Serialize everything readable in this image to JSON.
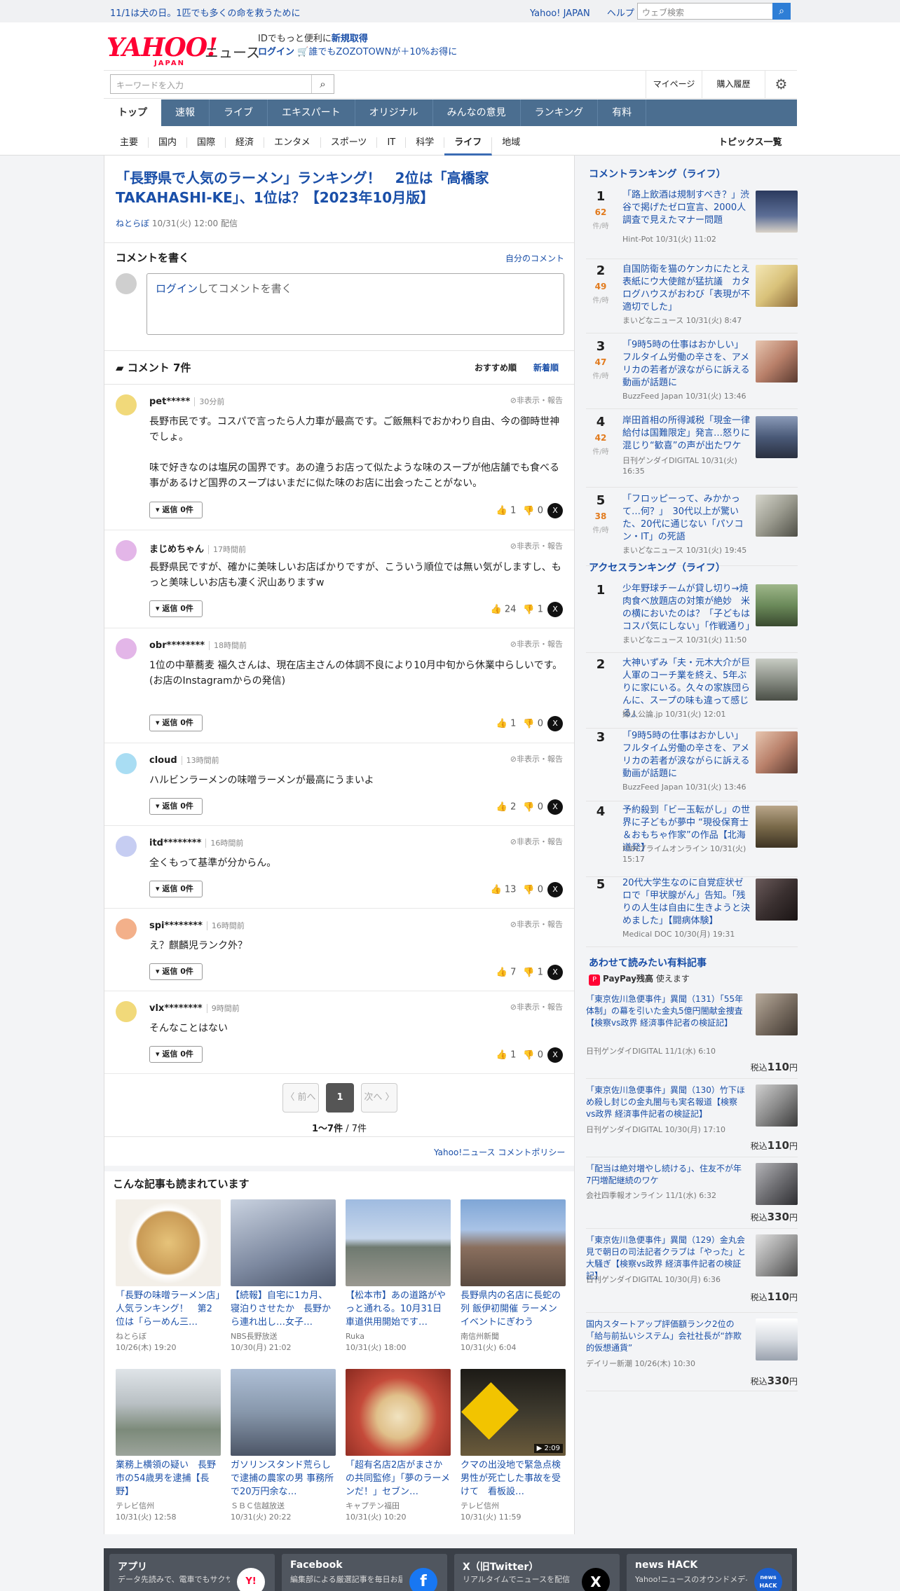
{
  "topbar": {
    "notice": "11/1は犬の日。1匹でも多くの命を救うために",
    "links": [
      "Yahoo! JAPAN",
      "ヘルプ"
    ],
    "search_placeholder": "ウェブ検索"
  },
  "header": {
    "logo_text": "YAHOO!",
    "logo_sub": "JAPAN",
    "logo_news": "ニュース",
    "promo_line1_prefix": "IDでもっと便利に",
    "promo_line1_link": "新規取得",
    "promo_line2_link": "ログイン",
    "promo_line2_text": "誰でもZOZOTOWNが＋10%お得に",
    "keyword_placeholder": "キーワードを入力",
    "mypage": "マイページ",
    "history": "購入履歴"
  },
  "main_nav": [
    "トップ",
    "速報",
    "ライブ",
    "エキスパート",
    "オリジナル",
    "みんなの意見",
    "ランキング",
    "有料"
  ],
  "sub_nav": [
    "主要",
    "国内",
    "国際",
    "経済",
    "エンタメ",
    "スポーツ",
    "IT",
    "科学",
    "ライフ",
    "地域"
  ],
  "topics_all": "トピックス一覧",
  "article": {
    "title": "「長野県で人気のラーメン」ランキング！　2位は「高橋家 TAKAHASHI-KE」、1位は？【2023年10月版】",
    "source": "ねとらぼ",
    "date": "10/31(火) 12:00",
    "date_suffix": "配信"
  },
  "comment_write": {
    "label": "コメントを書く",
    "my_comment": "自分のコメント",
    "login": "ログイン",
    "placeholder": "してコメントを書く"
  },
  "comments_header": {
    "title": "コメント 7件",
    "sort_recommended": "おすすめ順",
    "sort_new": "新着順"
  },
  "comments": [
    {
      "user": "pet*****",
      "time": "30分前",
      "hide": "非表示・報告",
      "text": "長野市民です。コスパで言ったら人力車が最高です。ご飯無料でおかわり自由、今の御時世神でしょ。\n\n味で好きなのは塩尻の国界です。あの違うお店って似たような味のスープが他店舗でも食べる事があるけど国界のスープはいまだに似た味のお店に出会ったことがない。",
      "reply": "返信 0件",
      "good": "1",
      "bad": "0",
      "avatar_color": "#f1d97a"
    },
    {
      "user": "まじめちゃん",
      "time": "17時間前",
      "hide": "非表示・報告",
      "text": "長野県民ですが、確かに美味しいお店ばかりですが、こういう順位では無い気がしますし、もっと美味しいお店も凄く沢山ありますw",
      "reply": "返信 0件",
      "good": "24",
      "bad": "1",
      "avatar_color": "#e3b6e8"
    },
    {
      "user": "obr********",
      "time": "18時間前",
      "hide": "非表示・報告",
      "text": "1位の中華蕎麦 福久さんは、現在店主さんの体調不良により10月中旬から休業中らしいです。\n(お店のInstagramからの発信)",
      "reply": "返信 0件",
      "good": "1",
      "bad": "0",
      "avatar_color": "#e3b6e8"
    },
    {
      "user": "cloud",
      "time": "13時間前",
      "hide": "非表示・報告",
      "text": "ハルビンラーメンの味噌ラーメンが最高にうまいよ",
      "reply": "返信 0件",
      "good": "2",
      "bad": "0",
      "avatar_color": "#a9ddf3"
    },
    {
      "user": "itd********",
      "time": "16時間前",
      "hide": "非表示・報告",
      "text": "全くもって基準が分からん。",
      "reply": "返信 0件",
      "good": "13",
      "bad": "0",
      "avatar_color": "#c6cdf2"
    },
    {
      "user": "spi********",
      "time": "16時間前",
      "hide": "非表示・報告",
      "text": "え？麒麟児ランク外？",
      "reply": "返信 0件",
      "good": "7",
      "bad": "1",
      "avatar_color": "#f3b08a"
    },
    {
      "user": "vlx********",
      "time": "9時間前",
      "hide": "非表示・報告",
      "text": "そんなことはない",
      "reply": "返信 0件",
      "good": "1",
      "bad": "0",
      "avatar_color": "#f1d97a"
    }
  ],
  "pager": {
    "prev": "〈 前へ",
    "current": "1",
    "next": "次へ 〉",
    "range": "1〜7件",
    "total": " / 7件"
  },
  "policy": "Yahoo!ニュース コメントポリシー",
  "related": {
    "title": "こんな記事も読まれています",
    "items": [
      {
        "title": "「長野の味噌ラーメン店」人気ランキング！　第2位は「らーめん三…",
        "source": "ねとらぼ",
        "date": "10/26(木) 19:20",
        "color": "#c99a55"
      },
      {
        "title": "【続報】自宅に1カ月、寝泊りさせたか　長野から連れ出し…女子…",
        "source": "NBS長野放送",
        "date": "10/30(月) 21:02",
        "color": "#8a94a8"
      },
      {
        "title": "【松本市】あの道路がやっと通れる。10月31日車道供用開始です…",
        "source": "Ruka",
        "date": "10/31(火) 18:00",
        "color": "#7f98b8"
      },
      {
        "title": "長野県内の名店に長蛇の列 飯伊初開催 ラーメンイベントにぎわう",
        "source": "南信州新聞",
        "date": "10/31(火) 6:04",
        "color": "#6a87b0"
      },
      {
        "title": "業務上横領の疑い　長野市の54歳男を逮捕【長野】",
        "source": "テレビ信州",
        "date": "10/31(火) 12:58",
        "color": "#9aa59b"
      },
      {
        "title": "ガソリンスタンド荒らしで逮捕の農家の男 事務所で20万円余な…",
        "source": "ＳＢＣ信越放送",
        "date": "10/31(火) 20:22",
        "color": "#7d8fa6"
      },
      {
        "title": "「超有名店2店がまさかの共同監修」「夢のラーメンだ！」セブン…",
        "source": "キャプテン福田",
        "date": "10/31(火) 10:20",
        "color": "#c54a3a"
      },
      {
        "title": "クマの出没地で緊急点検　男性が死亡した事故を受けて　看板設…",
        "source": "テレビ信州",
        "date": "10/31(火) 11:59",
        "color": "#3e3a2e",
        "duration": "▶ 2:09"
      }
    ]
  },
  "comment_ranking": {
    "title": "コメントランキング（ライフ）",
    "unit": "件/時",
    "items": [
      {
        "rank": "1",
        "count": "62",
        "title": "「路上飲酒は規制すべき？」渋谷で掲げたゼロ宣言、2000人調査で見えたマナー問題",
        "source": "Hint-Pot 10/31(火) 11:02",
        "color": "#3d4f7a"
      },
      {
        "rank": "2",
        "count": "49",
        "title": "自国防衛を猫のケンカにたとえ表紙にウ大使館が猛抗議　カタログハウスがおわび「表現が不適切でした」",
        "source": "まいどなニュース 10/31(火) 8:47",
        "color": "#d9c27a"
      },
      {
        "rank": "3",
        "count": "47",
        "title": "「9時5時の仕事はおかしい」フルタイム労働の辛さを、アメリカの若者が涙ながらに訴える動画が話題に",
        "source": "BuzzFeed Japan 10/31(火) 13:46",
        "color": "#b9806a"
      },
      {
        "rank": "4",
        "count": "42",
        "title": "岸田首相の所得減税「現金一律給付は国難限定」発言…怒りに混じり“歓喜”の声が出たワケ",
        "source": "日刊ゲンダイDIGITAL 10/31(火) 16:35",
        "color": "#4a5a78"
      },
      {
        "rank": "5",
        "count": "38",
        "title": "「フロッピーって、みかかって…何？」　30代以上が驚いた、20代に通じない「パソコン・IT」の死語",
        "source": "まいどなニュース 10/31(火) 19:45",
        "color": "#9a9a8e"
      }
    ]
  },
  "access_ranking": {
    "title": "アクセスランキング（ライフ）",
    "items": [
      {
        "rank": "1",
        "title": "少年野球チームが貸し切り→焼肉食べ放題店の対策が絶妙　米の横においたのは？「子どもはコスパ気にしない」「作戦通り」",
        "source": "まいどなニュース 10/31(火) 11:50",
        "color": "#6b8a5a"
      },
      {
        "rank": "2",
        "title": "大神いずみ「夫・元木大介が巨人軍のコーチ業を終え、5年ぶりに家にいる。久々の家族団らんに、スープの味も違って感じる」",
        "source": "婦人公論.jp 10/31(火) 12:01",
        "color": "#8a8f86"
      },
      {
        "rank": "3",
        "title": "「9時5時の仕事はおかしい」フルタイム労働の辛さを、アメリカの若者が涙ながらに訴える動画が話題に",
        "source": "BuzzFeed Japan 10/31(火) 13:46",
        "color": "#b9806a"
      },
      {
        "rank": "4",
        "title": "予約殺到「ビー玉転がし」の世界に子どもが夢中 “現役保育士＆おもちゃ作家”の作品【北海道発】",
        "source": "FNNプライムオンライン 10/31(火) 15:17",
        "color": "#7a6a4a"
      },
      {
        "rank": "5",
        "title": "20代大学生なのに自覚症状ゼロで「甲状腺がん」告知。「残りの人生は自由に生きようと決めました」【闘病体験】",
        "source": "Medical DOC 10/30(月) 19:31",
        "color": "#3a3030"
      }
    ]
  },
  "paid_articles": {
    "title": "あわせて読みたい有料記事",
    "paypay_icon": "P",
    "paypay_label": "PayPay残高",
    "paypay_suffix": "使えます",
    "price_prefix": "税込",
    "price_suffix": "円",
    "items": [
      {
        "title": "「東京佐川急便事件」異聞（131）「55年体制」の幕を引いた金丸5億円闇献金捜査【検察vs政界 経済事件記者の検証記】",
        "source": "日刊ゲンダイDIGITAL 11/1(水) 6:10",
        "price": "110",
        "color": "#7a6e62"
      },
      {
        "title": "「東京佐川急便事件」異聞（130）竹下ほめ殺し封じの金丸闇与も実名報道【検察vs政界 経済事件記者の検証記】",
        "source": "日刊ゲンダイDIGITAL 10/30(月) 17:10",
        "price": "110",
        "color": "#8a8a8a"
      },
      {
        "title": "「配当は絶対増やし続ける」、住友不が年7円増配継続のワケ",
        "source": "会社四季報オンライン 11/1(水) 6:32",
        "price": "330",
        "color": "#6e6e72"
      },
      {
        "title": "「東京佐川急便事件」異聞（129）金丸会見で朝日の司法記者クラブは「やった」と大騒ぎ【検察vs政界 経済事件記者の検証記】",
        "source": "日刊ゲンダイDIGITAL 10/30(月) 6:36",
        "price": "110",
        "color": "#9a9a9a"
      },
      {
        "title": "国内スタートアップ評価額ランク2位の「給与前払いシステム」会社社長が“詐欺的仮想通貨”",
        "source": "デイリー新潮 10/26(木) 10:30",
        "price": "330",
        "color": "#d8dce2"
      }
    ]
  },
  "footer": [
    {
      "title": "アプリ",
      "desc": "データ先読みで、電車でもサクサク",
      "icon": "Y!"
    },
    {
      "title": "Facebook",
      "desc": "編集部による厳選記事を毎日お届け",
      "icon": "f"
    },
    {
      "title": "X（旧Twitter）",
      "desc": "リアルタイムでニュースを配信",
      "icon": "X"
    },
    {
      "title": "news HACK",
      "desc": "Yahoo!ニュースのオウンドメディア",
      "icon": "news HACK"
    }
  ]
}
